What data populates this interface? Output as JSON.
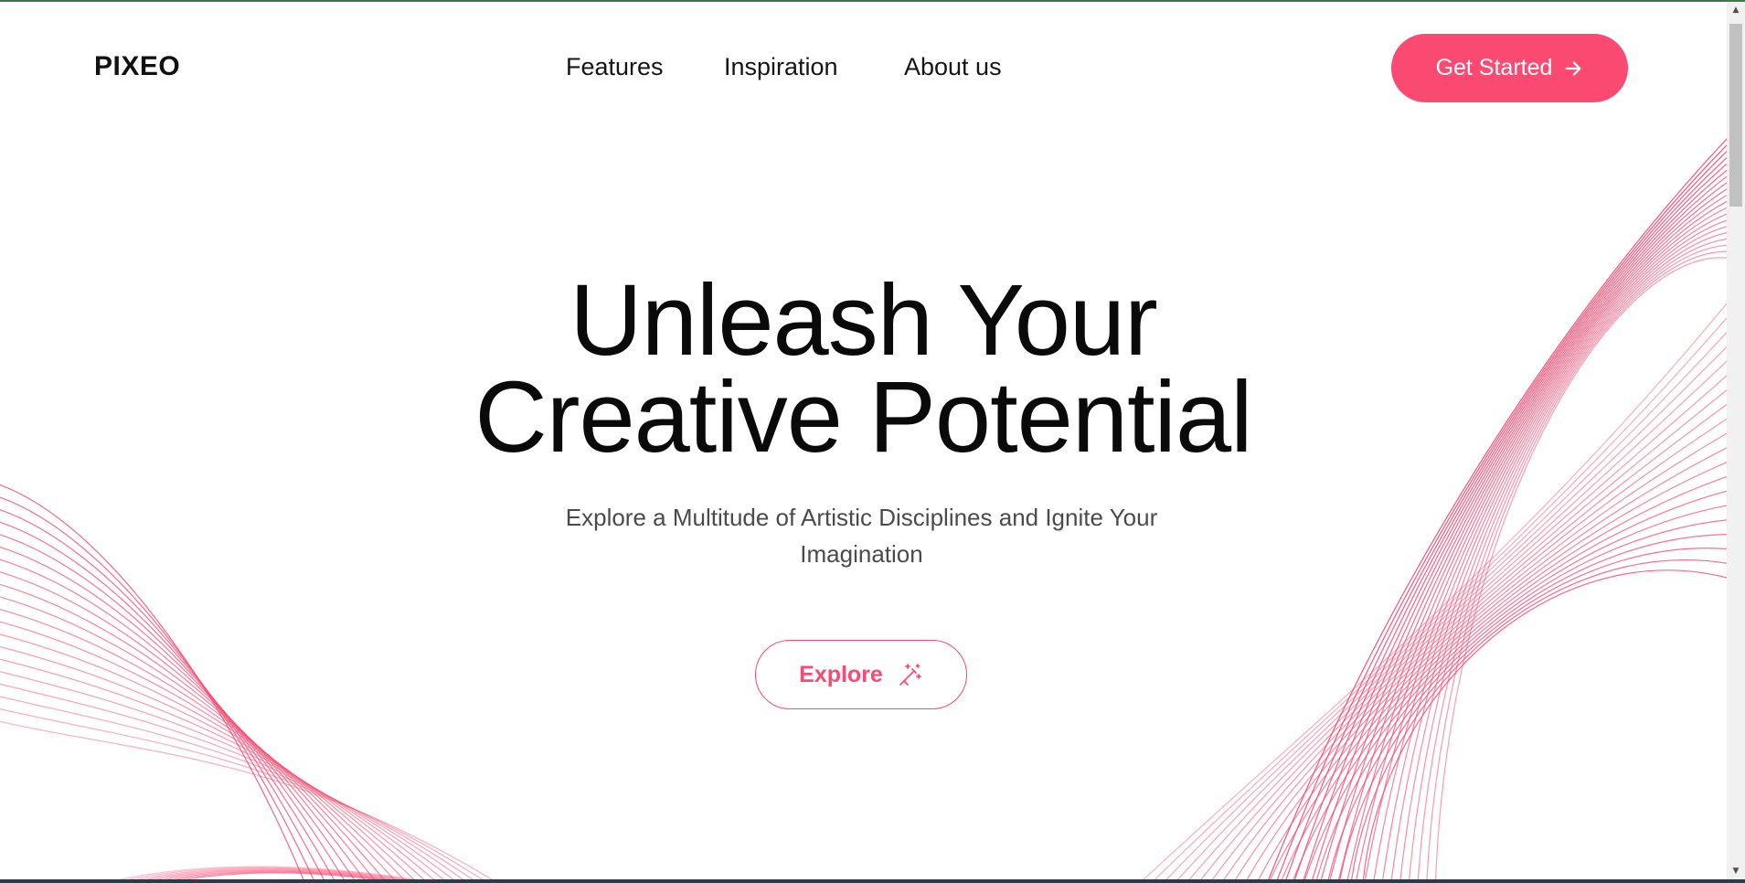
{
  "brand": {
    "name": "PIXEO",
    "accent_color": "#fb4a72",
    "text_color": "#0a0a0a"
  },
  "nav": {
    "items": [
      {
        "label": "Features"
      },
      {
        "label": "Inspiration"
      },
      {
        "label": "About us"
      }
    ]
  },
  "cta": {
    "label": "Get Started",
    "icon": "arrow-right-icon"
  },
  "hero": {
    "headline_line1": "Unleash Your",
    "headline_line2": "Creative Potential",
    "subtitle": "Explore a Multitude of Artistic Disciplines and Ignite Your Imagination",
    "explore_label": "Explore",
    "explore_icon": "magic-wand-icon"
  },
  "decoration": {
    "wave_color": "#fb4a72"
  }
}
